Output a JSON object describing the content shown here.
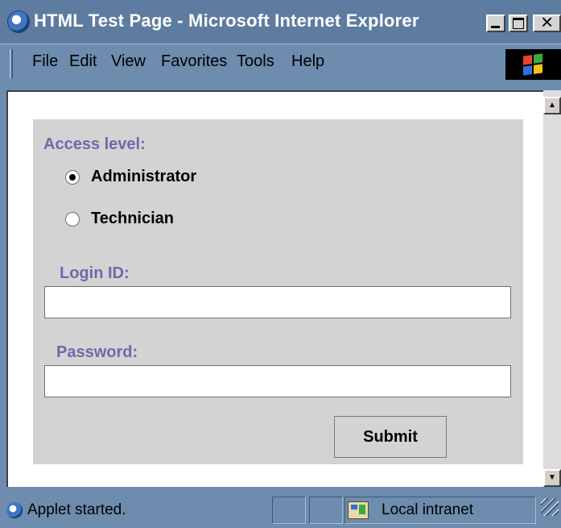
{
  "window": {
    "title": "HTML Test Page - Microsoft Internet Explorer",
    "icon": "ie-icon"
  },
  "menu": {
    "items": [
      "File",
      "Edit",
      "View",
      "Favorites",
      "Tools",
      "Help"
    ]
  },
  "form": {
    "access_level_label": "Access level:",
    "options": [
      {
        "label": "Administrator",
        "selected": true
      },
      {
        "label": "Technician",
        "selected": false
      }
    ],
    "login_label": "Login ID:",
    "login_value": "",
    "password_label": "Password:",
    "password_value": "",
    "submit_label": "Submit"
  },
  "statusbar": {
    "status_text": "Applet started.",
    "zone_text": "Local intranet"
  },
  "colors": {
    "chrome": "#6d8cae",
    "applet_bg": "#d3d3d3",
    "label_purple": "#6b6bab"
  }
}
